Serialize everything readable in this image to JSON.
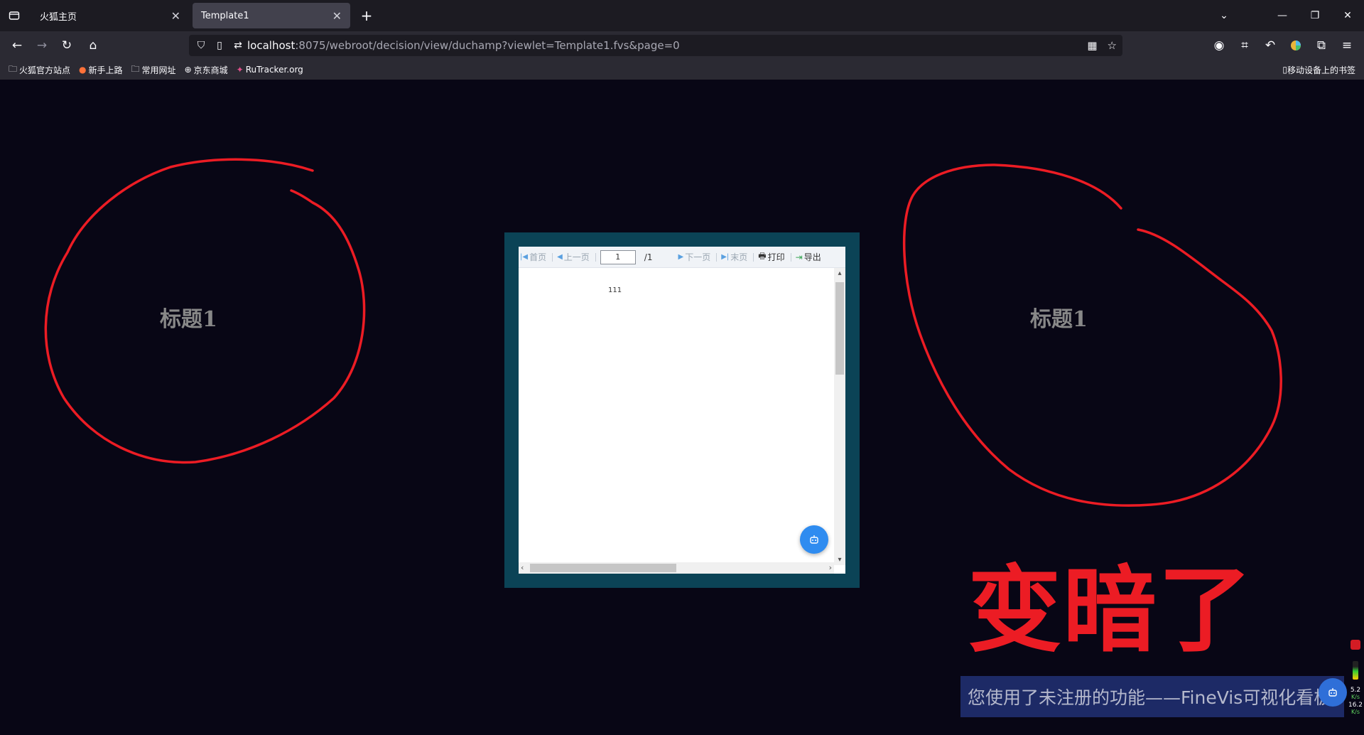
{
  "browser": {
    "tabs": [
      {
        "label": "火狐主页",
        "active": false
      },
      {
        "label": "Template1",
        "active": true
      }
    ],
    "url": {
      "host": "localhost",
      "rest": ":8075/webroot/decision/view/duchamp?viewlet=Template1.fvs&page=0"
    },
    "bookmarks": [
      {
        "label": "火狐官方站点",
        "icon": "folder-icon"
      },
      {
        "label": "新手上路",
        "icon": "firefox-icon"
      },
      {
        "label": "常用网址",
        "icon": "folder-icon"
      },
      {
        "label": "京东商城",
        "icon": "globe-icon"
      },
      {
        "label": "RuTracker.org",
        "icon": "rutracker-icon"
      }
    ],
    "mobile_bookmarks": "移动设备上的书签"
  },
  "page": {
    "title_left": "标题1",
    "title_right": "标题1",
    "annotation": "变暗了",
    "watermark": "您使用了未注册的功能——FineVis可视化看板"
  },
  "report": {
    "toolbar": {
      "first": "首页",
      "prev": "上一页",
      "page_value": "1",
      "page_total": "/1",
      "next": "下一页",
      "last": "末页",
      "print": "打印",
      "export": "导出"
    },
    "cell_value": "111"
  },
  "net_monitor": {
    "upload": "5.2",
    "upload_unit": "K/s",
    "download": "16.2",
    "download_unit": "K/s"
  },
  "colors": {
    "page_bg": "#080615",
    "frame_bg": "#0b4356",
    "annotation_red": "#ec1c24",
    "fab_blue": "#2f8cf0"
  }
}
